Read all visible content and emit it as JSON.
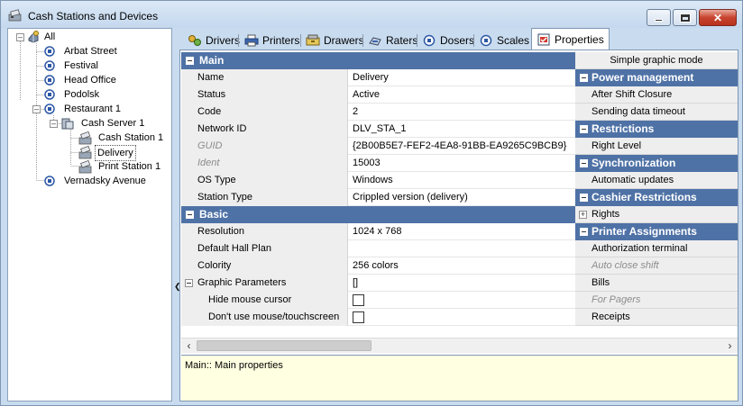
{
  "window": {
    "title": "Cash Stations and Devices"
  },
  "tree": [
    {
      "label": "All"
    },
    {
      "label": "Arbat Street"
    },
    {
      "label": "Festival"
    },
    {
      "label": "Head Office"
    },
    {
      "label": "Podolsk"
    },
    {
      "label": "Restaurant 1"
    },
    {
      "label": "Cash Server 1"
    },
    {
      "label": "Cash Station 1"
    },
    {
      "label": "Delivery",
      "selected": true
    },
    {
      "label": "Print Station 1"
    },
    {
      "label": "Vernadsky Avenue"
    }
  ],
  "tabs": [
    {
      "label": "Drivers",
      "icon": "drivers-icon"
    },
    {
      "label": "Printers",
      "icon": "printer-icon"
    },
    {
      "label": "Drawers",
      "icon": "drawer-icon"
    },
    {
      "label": "Raters",
      "icon": "rater-icon"
    },
    {
      "label": "Dosers",
      "icon": "doser-icon"
    },
    {
      "label": "Scales",
      "icon": "scales-icon"
    },
    {
      "label": "Properties",
      "icon": "properties-icon",
      "active": true
    }
  ],
  "properties": {
    "main": {
      "title": "Main",
      "rows": [
        {
          "key": "Name",
          "value": "Delivery"
        },
        {
          "key": "Status",
          "value": "Active"
        },
        {
          "key": "Code",
          "value": "2"
        },
        {
          "key": "Network ID",
          "value": "DLV_STA_1"
        },
        {
          "key": "GUID",
          "value": "{2B00B5E7-FEF2-4EA8-91BB-EA9265C9BCB9}"
        },
        {
          "key": "Ident",
          "value": "15003"
        },
        {
          "key": "OS Type",
          "value": "Windows"
        },
        {
          "key": "Station Type",
          "value": "Crippled version (delivery)"
        }
      ]
    },
    "basic": {
      "title": "Basic",
      "rows": [
        {
          "key": "Resolution",
          "value": "1024 x 768"
        },
        {
          "key": "Default Hall Plan",
          "value": ""
        },
        {
          "key": "Colority",
          "value": "256 colors"
        },
        {
          "key": "Graphic Parameters",
          "value": "[]"
        },
        {
          "key": "Hide mouse cursor",
          "value": ""
        },
        {
          "key": "Don't use mouse/touchscreen",
          "value": ""
        }
      ]
    }
  },
  "right_panel": {
    "simple_mode": "Simple graphic mode",
    "power_title": "Power management",
    "power_items": [
      "After Shift Closure",
      "Sending data timeout"
    ],
    "restrictions_title": "Restrictions",
    "restrictions_items": [
      "Right Level"
    ],
    "sync_title": "Synchronization",
    "sync_items": [
      "Automatic updates"
    ],
    "cashier_title": "Cashier Restrictions",
    "cashier_items": [
      "Rights"
    ],
    "printer_title": "Printer Assignments",
    "printer_items": [
      "Authorization terminal",
      "Auto close shift",
      "Bills",
      "For Pagers",
      "Receipts"
    ]
  },
  "description": "Main:: Main properties"
}
